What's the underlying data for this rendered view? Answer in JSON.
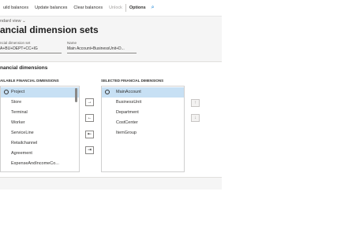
{
  "toolbar": {
    "items": [
      "uild balances",
      "Update balances",
      "Clear balances",
      "Unlock",
      "Options"
    ]
  },
  "view": {
    "label": "ndard view",
    "chevron": "chevron-down-icon"
  },
  "page": {
    "title": "ancial dimension sets"
  },
  "fields": {
    "set": {
      "label": "ncial dimension set",
      "value": "A+BU+DEPT+CC+IG"
    },
    "name": {
      "label": "Name",
      "value": "Main Account+BusinessUnit+D..."
    }
  },
  "section": {
    "title": "nancial dimensions"
  },
  "available": {
    "header": "AILABLE FINANCIAL DIMENSIONS",
    "items": [
      "Project",
      "Store",
      "Terminal",
      "Worker",
      "ServiceLine",
      "Retailchannel",
      "Agreement",
      "ExpenseAndIncomeCo..."
    ]
  },
  "selected": {
    "header": "SELECTED FINANCIAL DIMENSIONS",
    "items": [
      "MainAccount",
      "BusinessUnit",
      "Department",
      "CostCenter",
      "ItemGroup"
    ]
  },
  "buttons": {
    "add": "→",
    "remove": "←",
    "remove_all": "⇤",
    "add_all": "⇥",
    "move_up": "↑",
    "move_down": "↓"
  },
  "icons": {
    "search": "search-icon",
    "radio": "radio-icon"
  },
  "colors": {
    "accent": "#0078d4",
    "selection": "#c7e0f4",
    "background": "#f5f5f5"
  }
}
